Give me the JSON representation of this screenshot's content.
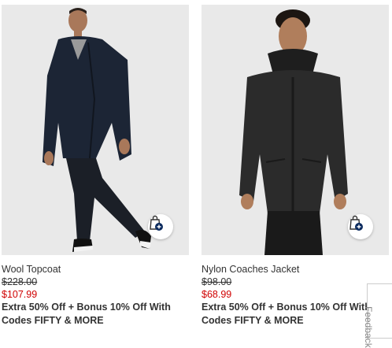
{
  "products": [
    {
      "name": "Wool Topcoat",
      "original_price": "$228.00",
      "sale_price": "$107.99",
      "promo_text": "Extra 50% Off + Bonus 10% Off With Codes FIFTY & MORE"
    },
    {
      "name": "Nylon Coaches Jacket",
      "original_price": "$98.00",
      "sale_price": "$68.99",
      "promo_text": "Extra 50% Off + Bonus 10% Off With Codes FIFTY & MORE"
    }
  ],
  "feedback": {
    "label": "Feedback"
  },
  "colors": {
    "sale": "#d00000",
    "bag_plus": "#0a2a5e",
    "photo_bg": "#e9e9e9"
  },
  "icons": {
    "add_to_bag": "shopping-bag-plus-icon"
  }
}
